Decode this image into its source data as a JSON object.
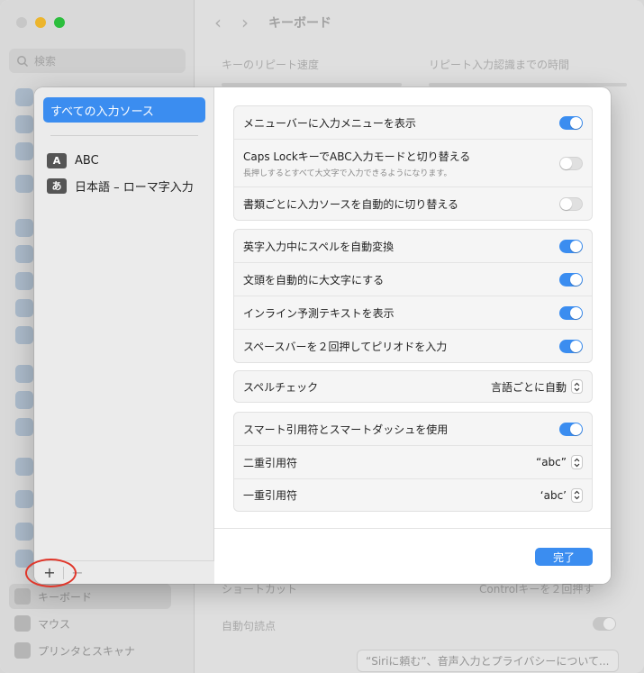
{
  "window": {
    "title": "キーボード",
    "search_placeholder": "検索"
  },
  "background": {
    "key_repeat_label": "キーのリピート速度",
    "delay_label": "リピート入力認識までの時間",
    "sidebar": [
      {
        "label": "キーボード",
        "selected": true
      },
      {
        "label": "マウス",
        "selected": false
      },
      {
        "label": "プリンタとスキャナ",
        "selected": false
      }
    ],
    "shortcut_label": "ショートカット",
    "shortcut_value": "Controlキーを２回押す",
    "auto_punct_label": "自動句読点",
    "siri_button": "“Siriに頼む”、音声入力とプライバシーについて..."
  },
  "input_sources": {
    "all_label": "すべての入力ソース",
    "items": [
      {
        "badge": "A",
        "label": "ABC"
      },
      {
        "badge": "あ",
        "label": "日本語 – ローマ字入力"
      }
    ],
    "add_label": "+",
    "remove_label": "−"
  },
  "settings": {
    "group1": [
      {
        "label": "メニューバーに入力メニューを表示",
        "on": true
      },
      {
        "label": "Caps LockキーでABC入力モードと切り替える",
        "sub": "長押しするとすべて大文字で入力できるようになります。",
        "on": false
      },
      {
        "label": "書類ごとに入力ソースを自動的に切り替える",
        "on": false
      }
    ],
    "group2": [
      {
        "label": "英字入力中にスペルを自動変換",
        "on": true
      },
      {
        "label": "文頭を自動的に大文字にする",
        "on": true
      },
      {
        "label": "インライン予測テキストを表示",
        "on": true
      },
      {
        "label": "スペースバーを２回押してピリオドを入力",
        "on": true
      }
    ],
    "spell_check": {
      "label": "スペルチェック",
      "value": "言語ごとに自動"
    },
    "group4": {
      "smart_quotes": {
        "label": "スマート引用符とスマートダッシュを使用",
        "on": true
      },
      "double_quote": {
        "label": "二重引用符",
        "value": "“abc”"
      },
      "single_quote": {
        "label": "一重引用符",
        "value": "‘abc’"
      }
    },
    "done_label": "完了"
  },
  "colors": {
    "accent": "#3b8df0",
    "highlight_ring": "#e0362a"
  }
}
